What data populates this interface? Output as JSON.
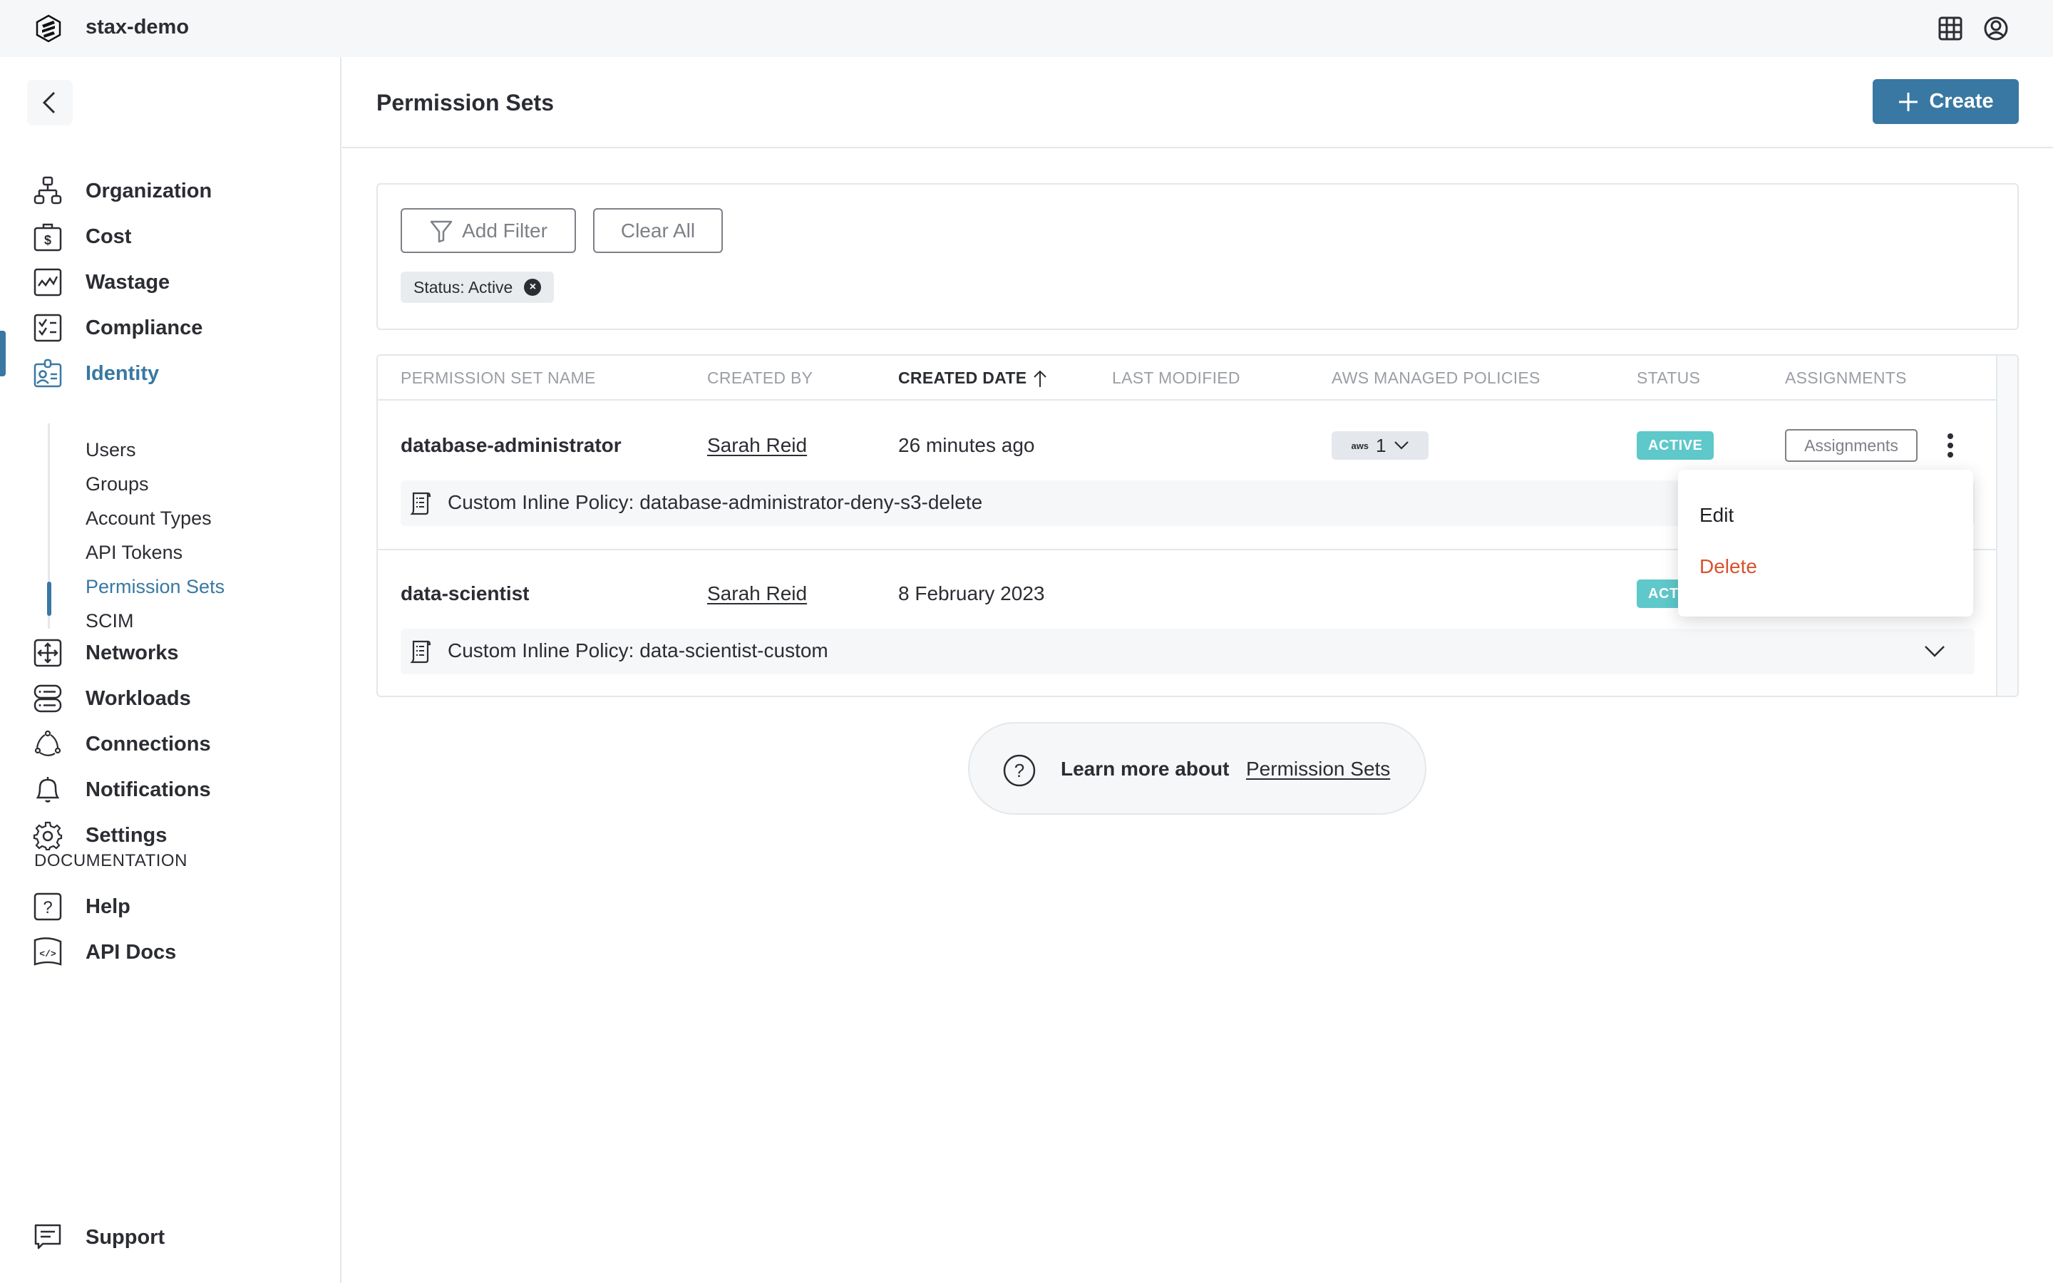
{
  "topbar": {
    "org_name": "stax-demo",
    "icons": [
      "stax-logo-icon",
      "apps-grid-icon",
      "user-account-icon"
    ]
  },
  "sidebar": {
    "collapse_icon": "chevron-left-icon",
    "items": [
      {
        "label": "Organization",
        "icon": "org-chart-icon",
        "active": false
      },
      {
        "label": "Cost",
        "icon": "dollar-bag-icon",
        "active": false
      },
      {
        "label": "Wastage",
        "icon": "chart-line-icon",
        "active": false
      },
      {
        "label": "Compliance",
        "icon": "checklist-icon",
        "active": false
      },
      {
        "label": "Identity",
        "icon": "id-badge-icon",
        "active": true
      },
      {
        "label": "Networks",
        "icon": "move-arrows-icon",
        "active": false
      },
      {
        "label": "Workloads",
        "icon": "server-stack-icon",
        "active": false
      },
      {
        "label": "Connections",
        "icon": "connections-icon",
        "active": false
      },
      {
        "label": "Notifications",
        "icon": "bell-icon",
        "active": false
      },
      {
        "label": "Settings",
        "icon": "gear-icon",
        "active": false
      }
    ],
    "identity_sub_items": [
      {
        "label": "Users",
        "active": false
      },
      {
        "label": "Groups",
        "active": false
      },
      {
        "label": "Account Types",
        "active": false
      },
      {
        "label": "API Tokens",
        "active": false
      },
      {
        "label": "Permission Sets",
        "active": true
      },
      {
        "label": "SCIM",
        "active": false
      }
    ],
    "documentation_heading": "DOCUMENTATION",
    "doc_items": [
      {
        "label": "Help",
        "icon": "help-square-icon"
      },
      {
        "label": "API Docs",
        "icon": "code-flag-icon"
      }
    ],
    "support": {
      "label": "Support",
      "icon": "chat-bubble-icon"
    }
  },
  "page": {
    "title": "Permission Sets",
    "create_label": "Create"
  },
  "filters": {
    "add_filter_label": "Add Filter",
    "clear_all_label": "Clear All",
    "chips": [
      {
        "label": "Status: Active"
      }
    ]
  },
  "table": {
    "columns": [
      {
        "label": "PERMISSION SET NAME",
        "sorted": false
      },
      {
        "label": "CREATED BY",
        "sorted": false
      },
      {
        "label": "CREATED DATE",
        "sorted": true,
        "direction": "ascending"
      },
      {
        "label": "LAST MODIFIED",
        "sorted": false
      },
      {
        "label": "AWS MANAGED POLICIES",
        "sorted": false
      },
      {
        "label": "STATUS",
        "sorted": false
      },
      {
        "label": "ASSIGNMENTS",
        "sorted": false
      }
    ],
    "rows": [
      {
        "name": "database-administrator",
        "created_by": "Sarah Reid",
        "created_date": "26 minutes ago",
        "last_modified": "",
        "aws_managed_policies_count": "1",
        "status": "ACTIVE",
        "assignments_label": "Assignments",
        "inline_policy": "Custom Inline Policy: database-administrator-deny-s3-delete"
      },
      {
        "name": "data-scientist",
        "created_by": "Sarah Reid",
        "created_date": "8 February 2023",
        "last_modified": "",
        "aws_managed_policies_count": "",
        "status": "ACTIVE",
        "status_visible_text": "ACT",
        "assignments_label": "",
        "inline_policy": "Custom Inline Policy: data-scientist-custom"
      }
    ],
    "aws_logo_text": "aws"
  },
  "row_menu": {
    "items": [
      {
        "label": "Edit",
        "color": "#1f2024"
      },
      {
        "label": "Delete",
        "color": "#d9512c"
      }
    ]
  },
  "learn_more": {
    "prefix": "Learn more about",
    "link": "Permission Sets"
  },
  "colors": {
    "accent": "#3878a3",
    "status_active": "#5ec8cb",
    "danger": "#d9512c",
    "header_bg": "#f6f7f9"
  }
}
